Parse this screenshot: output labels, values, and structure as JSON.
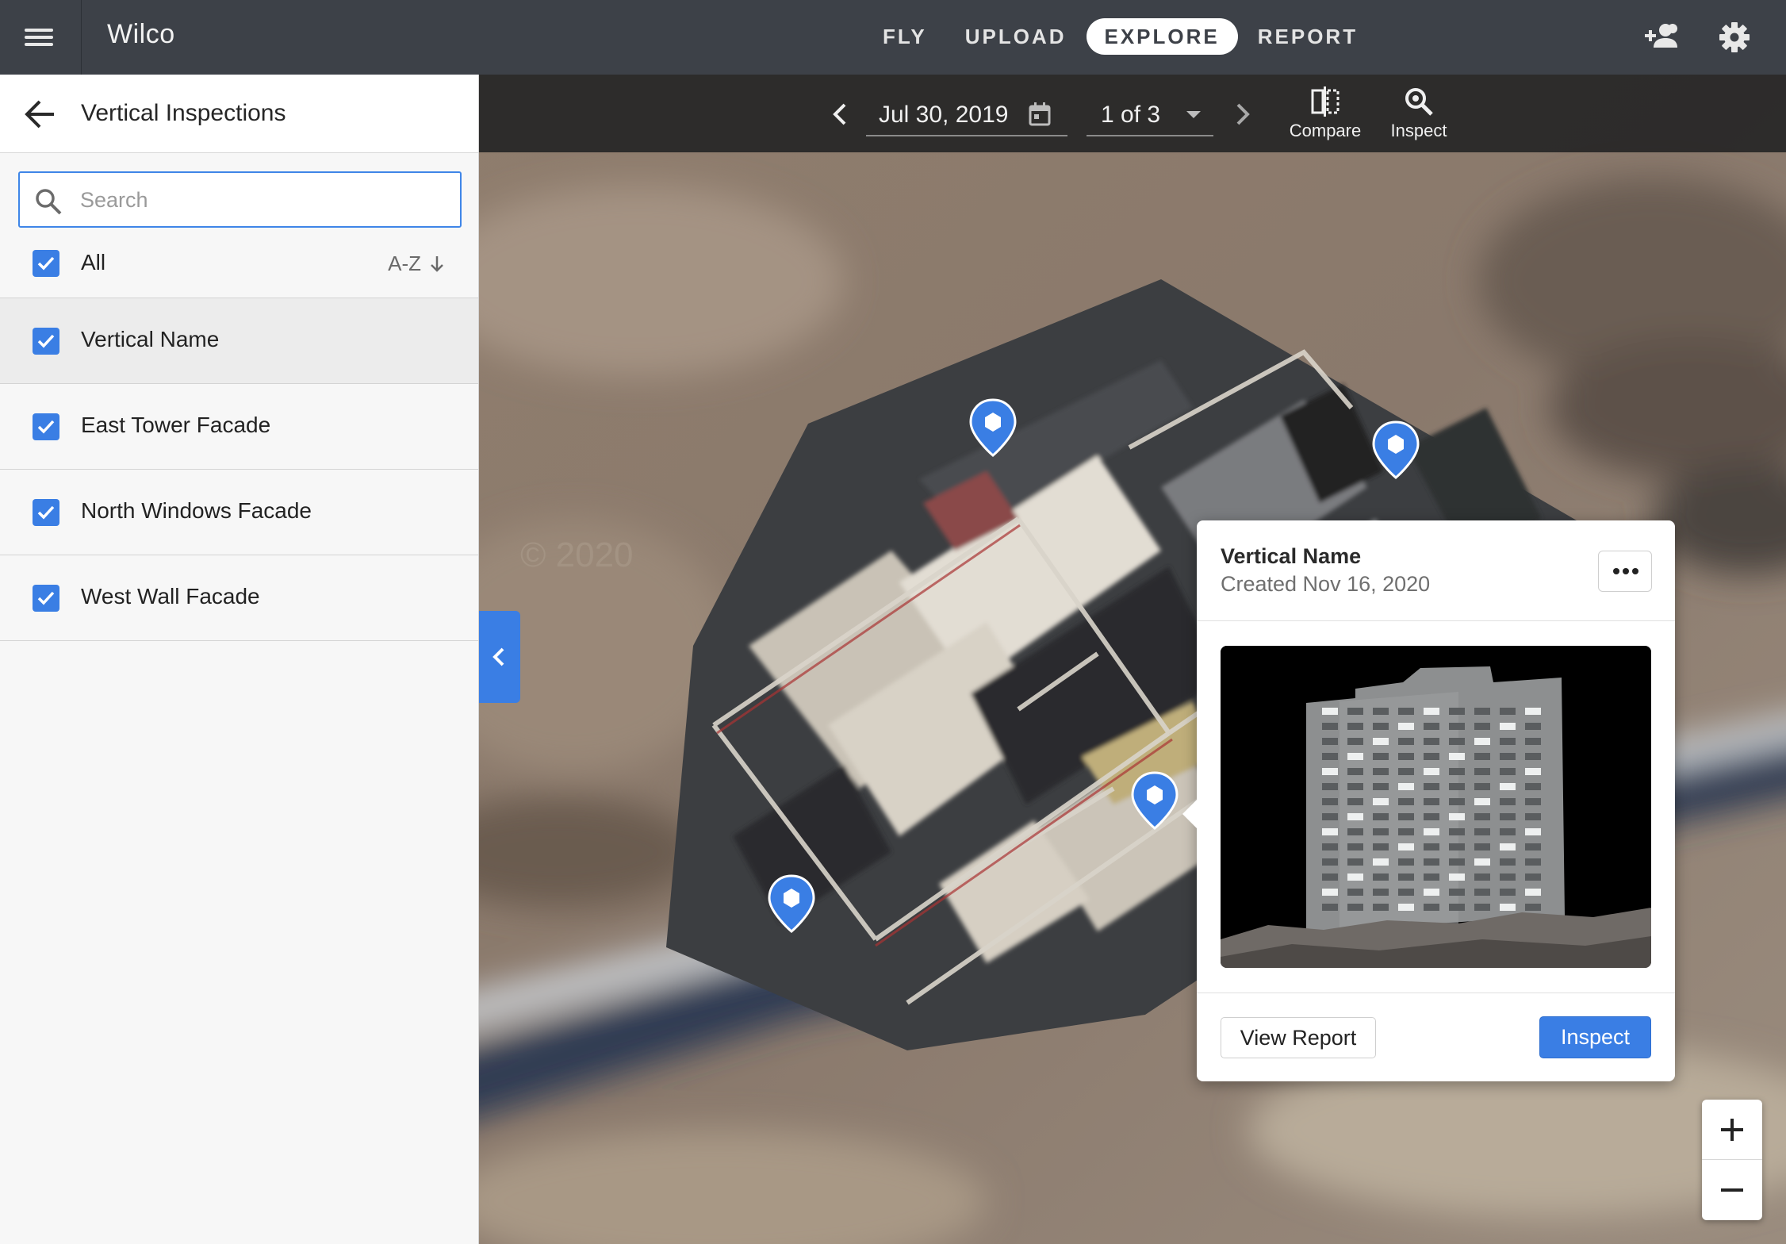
{
  "app": {
    "title": "Wilco"
  },
  "nav": {
    "tabs": [
      {
        "label": "FLY",
        "active": false
      },
      {
        "label": "UPLOAD",
        "active": false
      },
      {
        "label": "EXPLORE",
        "active": true
      },
      {
        "label": "REPORT",
        "active": false
      }
    ]
  },
  "topbar_icons": [
    "menu-icon",
    "add-user-icon",
    "gear-icon"
  ],
  "panel": {
    "title": "Vertical Inspections",
    "search": {
      "placeholder": "Search",
      "value": ""
    },
    "all_label": "All",
    "sort_label": "A-Z",
    "items": [
      {
        "label": "Vertical Name",
        "checked": true,
        "selected": true
      },
      {
        "label": "East Tower Facade",
        "checked": true,
        "selected": false
      },
      {
        "label": "North Windows Facade",
        "checked": true,
        "selected": false
      },
      {
        "label": "West Wall Facade",
        "checked": true,
        "selected": false
      }
    ]
  },
  "toolbar": {
    "date": "Jul 30, 2019",
    "page": "1 of 3",
    "compare_label": "Compare",
    "inspect_label": "Inspect"
  },
  "popup": {
    "title": "Vertical Name",
    "created": "Created Nov 16, 2020",
    "view_report_label": "View Report",
    "inspect_label": "Inspect"
  },
  "map": {
    "watermark": "© 2020",
    "markers": 4
  },
  "colors": {
    "topbar": "#3d4148",
    "accent": "#3a7ee4",
    "panel_bg": "#f7f7f7",
    "subbar": "#262626"
  }
}
